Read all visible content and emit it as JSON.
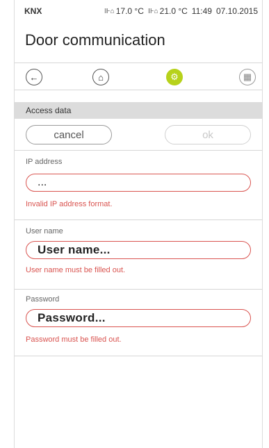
{
  "status_bar": {
    "brand": "KNX",
    "temp_outside": "17.0 °C",
    "temp_inside": "21.0 °C",
    "time": "11:49",
    "date": "07.10.2015"
  },
  "page": {
    "title": "Door communication"
  },
  "nav": {
    "back_icon": "←",
    "home_icon": "⌂",
    "settings_icon": "⚙",
    "grid_icon": "▦"
  },
  "section": {
    "title": "Access data"
  },
  "buttons": {
    "cancel": "cancel",
    "ok": "ok"
  },
  "form": {
    "ip": {
      "label": "IP address",
      "value": "...",
      "error": "Invalid IP address format."
    },
    "username": {
      "label": "User name",
      "placeholder": "User name...",
      "error": "User name must be filled out."
    },
    "password": {
      "label": "Password",
      "placeholder": "Password...",
      "error": "Password must be filled out."
    }
  },
  "colors": {
    "accent": "#b7d21b",
    "error": "#d9534f",
    "section_bg": "#dcdcdc"
  }
}
